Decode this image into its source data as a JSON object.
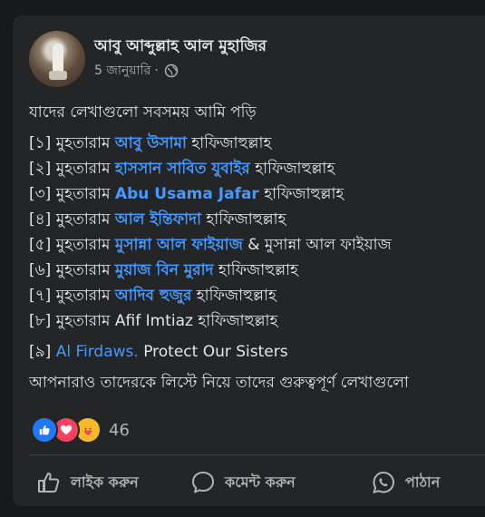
{
  "post": {
    "author": "আবু আব্দুল্লাহ আল মুহাজির",
    "date": "5 জানুয়ারি",
    "audience_icon": "globe-icon",
    "intro": "যাদের লেখাগুলো সবসময় আমি পড়ি",
    "title_word": "মুহতারাম",
    "suffix": "হাফিজাহুল্লাহ",
    "list": [
      {
        "num": "[১]",
        "name": "আবু উসামা"
      },
      {
        "num": "[২]",
        "name": "হাসসান সাবিত যুবাইর"
      },
      {
        "num": "[৩]",
        "name": "Abu Usama Jafar"
      },
      {
        "num": "[৪]",
        "name": "আল ইন্তিফাদা"
      },
      {
        "num": "[৫]",
        "name": "মুসান্না আল ফাইয়াজ",
        "extra": "& মুসান্না আল ফাইয়াজ"
      },
      {
        "num": "[৬]",
        "name": "মুয়াজ বিন মুরাদ"
      },
      {
        "num": "[৭]",
        "name": "আদিব হুজুর"
      },
      {
        "num": "[৮]",
        "plain_name": "Afif Imtiaz"
      }
    ],
    "item9_num": "[৯]",
    "item9_link": "Al Firdaws.",
    "item9_rest": "Protect Our Sisters",
    "closing": "আপনারাও তাদেরকে লিস্টে নিয়ে তাদের গুরুত্বপূর্ণ লেখাগুলো"
  },
  "reactions": {
    "icons": [
      "like-icon",
      "love-icon",
      "care-icon"
    ],
    "count": "46"
  },
  "actions": {
    "like": "লাইক করুন",
    "comment": "কমেন্ট করুন",
    "share": "পাঠান"
  },
  "colors": {
    "page_bg": "#18191a",
    "card_bg": "#242526",
    "text": "#e4e6eb",
    "secondary": "#b0b3b8",
    "link": "#4599ff"
  }
}
